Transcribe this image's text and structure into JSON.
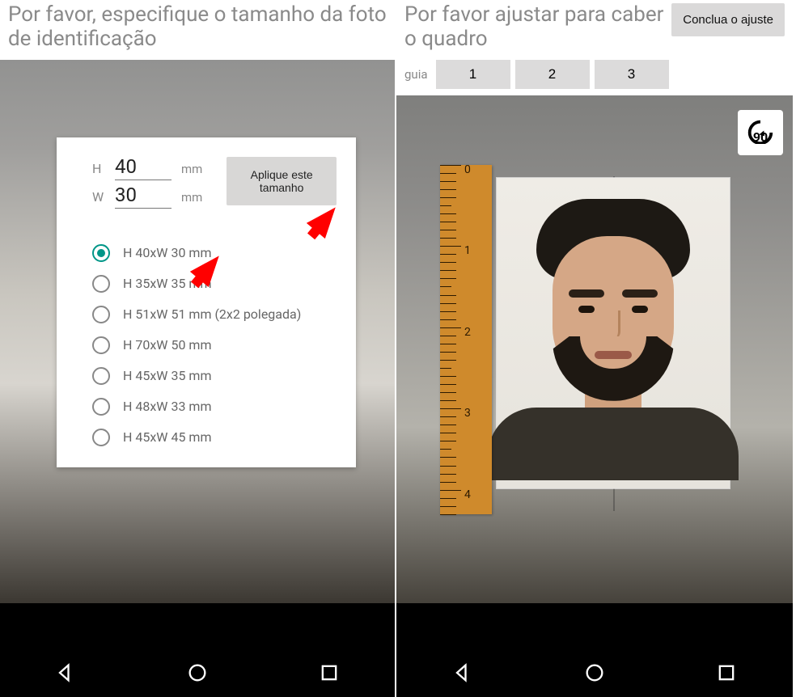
{
  "left": {
    "title": "Por favor, especifique o tamanho da foto de identificação",
    "height_label": "H",
    "height_value": "40",
    "width_label": "W",
    "width_value": "30",
    "unit": "mm",
    "apply_button": "Aplique este tamanho",
    "sizes": [
      {
        "label": "H 40xW 30 mm",
        "checked": true
      },
      {
        "label": "H 35xW 35 mm",
        "checked": false
      },
      {
        "label": "H 51xW 51 mm (2x2 polegada)",
        "checked": false
      },
      {
        "label": "H 70xW 50 mm",
        "checked": false
      },
      {
        "label": "H 45xW 35 mm",
        "checked": false
      },
      {
        "label": "H 48xW 33 mm",
        "checked": false
      },
      {
        "label": "H 45xW 45 mm",
        "checked": false
      }
    ]
  },
  "right": {
    "title": "Por favor ajustar para caber o quadro",
    "finish_button": "Conclua o ajuste",
    "guide_label": "guia",
    "guides": [
      "1",
      "2",
      "3"
    ],
    "rotate_label": "90",
    "ruler_marks": [
      "0",
      "1",
      "2",
      "3",
      "4"
    ]
  }
}
